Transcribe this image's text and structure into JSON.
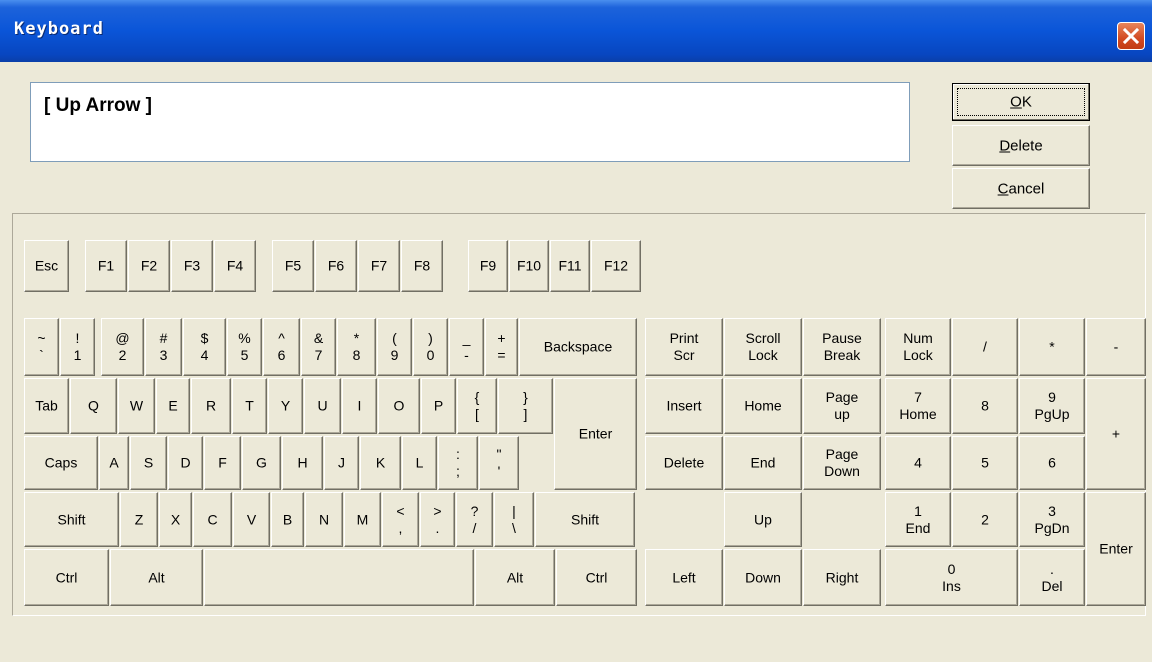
{
  "window": {
    "title": "Keyboard",
    "close_icon": "close-icon"
  },
  "display": {
    "value": "[ Up Arrow  ]"
  },
  "buttons": {
    "ok": {
      "label": "OK",
      "accel": "O",
      "rest": "K"
    },
    "delete": {
      "label": "Delete",
      "accel": "D",
      "rest": "elete"
    },
    "cancel": {
      "label": "Cancel",
      "accel": "C",
      "rest": "ancel"
    }
  },
  "keys": [
    {
      "id": "esc",
      "label": "Esc"
    },
    {
      "id": "f1",
      "label": "F1"
    },
    {
      "id": "f2",
      "label": "F2"
    },
    {
      "id": "f3",
      "label": "F3"
    },
    {
      "id": "f4",
      "label": "F4"
    },
    {
      "id": "f5",
      "label": "F5"
    },
    {
      "id": "f6",
      "label": "F6"
    },
    {
      "id": "f7",
      "label": "F7"
    },
    {
      "id": "f8",
      "label": "F8"
    },
    {
      "id": "f9",
      "label": "F9"
    },
    {
      "id": "f10",
      "label": "F10"
    },
    {
      "id": "f11",
      "label": "F11"
    },
    {
      "id": "f12",
      "label": "F12"
    },
    {
      "id": "tilde",
      "shift": "~",
      "base": "`"
    },
    {
      "id": "1",
      "shift": "!",
      "base": "1"
    },
    {
      "id": "2",
      "shift": "@",
      "base": "2"
    },
    {
      "id": "3",
      "shift": "#",
      "base": "3"
    },
    {
      "id": "4",
      "shift": "$",
      "base": "4"
    },
    {
      "id": "5",
      "shift": "%",
      "base": "5"
    },
    {
      "id": "6",
      "shift": "^",
      "base": "6"
    },
    {
      "id": "7",
      "shift": "&",
      "base": "7"
    },
    {
      "id": "8",
      "shift": "*",
      "base": "8"
    },
    {
      "id": "9",
      "shift": "(",
      "base": "9"
    },
    {
      "id": "0",
      "shift": ")",
      "base": "0"
    },
    {
      "id": "minus",
      "shift": "_",
      "base": "-"
    },
    {
      "id": "equals",
      "shift": "+",
      "base": "="
    },
    {
      "id": "backspace",
      "label": "Backspace"
    },
    {
      "id": "tab",
      "label": "Tab"
    },
    {
      "id": "q",
      "label": "Q"
    },
    {
      "id": "w",
      "label": "W"
    },
    {
      "id": "e",
      "label": "E"
    },
    {
      "id": "r",
      "label": "R"
    },
    {
      "id": "t",
      "label": "T"
    },
    {
      "id": "y",
      "label": "Y"
    },
    {
      "id": "u",
      "label": "U"
    },
    {
      "id": "i",
      "label": "I"
    },
    {
      "id": "o",
      "label": "O"
    },
    {
      "id": "p",
      "label": "P"
    },
    {
      "id": "lbracket",
      "shift": "{",
      "base": "["
    },
    {
      "id": "rbracket",
      "shift": "}",
      "base": "]"
    },
    {
      "id": "enter",
      "label": "Enter"
    },
    {
      "id": "caps",
      "label": "Caps"
    },
    {
      "id": "a",
      "label": "A"
    },
    {
      "id": "s",
      "label": "S"
    },
    {
      "id": "d",
      "label": "D"
    },
    {
      "id": "f",
      "label": "F"
    },
    {
      "id": "g",
      "label": "G"
    },
    {
      "id": "h",
      "label": "H"
    },
    {
      "id": "j",
      "label": "J"
    },
    {
      "id": "k",
      "label": "K"
    },
    {
      "id": "l",
      "label": "L"
    },
    {
      "id": "semicolon",
      "shift": ":",
      "base": ";"
    },
    {
      "id": "quote",
      "shift": "\"",
      "base": "'"
    },
    {
      "id": "lshift",
      "label": "Shift"
    },
    {
      "id": "z",
      "label": "Z"
    },
    {
      "id": "x",
      "label": "X"
    },
    {
      "id": "c",
      "label": "C"
    },
    {
      "id": "v",
      "label": "V"
    },
    {
      "id": "b",
      "label": "B"
    },
    {
      "id": "n",
      "label": "N"
    },
    {
      "id": "m",
      "label": "M"
    },
    {
      "id": "comma",
      "shift": "<",
      "base": ","
    },
    {
      "id": "period",
      "shift": ">",
      "base": "."
    },
    {
      "id": "slash",
      "shift": "?",
      "base": "/"
    },
    {
      "id": "backslash",
      "shift": "|",
      "base": "\\"
    },
    {
      "id": "rshift",
      "label": "Shift"
    },
    {
      "id": "lctrl",
      "label": "Ctrl"
    },
    {
      "id": "lalt",
      "label": "Alt"
    },
    {
      "id": "space",
      "label": ""
    },
    {
      "id": "ralt",
      "label": "Alt"
    },
    {
      "id": "rctrl",
      "label": "Ctrl"
    },
    {
      "id": "printscr",
      "label": "Print",
      "label2": "Scr"
    },
    {
      "id": "scrolllock",
      "label": "Scroll",
      "label2": "Lock"
    },
    {
      "id": "pause",
      "label": "Pause",
      "label2": "Break"
    },
    {
      "id": "insert",
      "label": "Insert"
    },
    {
      "id": "home",
      "label": "Home"
    },
    {
      "id": "pageup",
      "label": "Page",
      "label2": "up"
    },
    {
      "id": "delete",
      "label": "Delete"
    },
    {
      "id": "end",
      "label": "End"
    },
    {
      "id": "pagedown",
      "label": "Page",
      "label2": "Down"
    },
    {
      "id": "up",
      "label": "Up"
    },
    {
      "id": "left",
      "label": "Left"
    },
    {
      "id": "down",
      "label": "Down"
    },
    {
      "id": "right",
      "label": "Right"
    },
    {
      "id": "numlock",
      "label": "Num",
      "label2": "Lock"
    },
    {
      "id": "numdiv",
      "label": "/"
    },
    {
      "id": "nummul",
      "label": "*"
    },
    {
      "id": "numsub",
      "label": "-"
    },
    {
      "id": "num7",
      "label": "7",
      "label2": "Home"
    },
    {
      "id": "num8",
      "label": "8"
    },
    {
      "id": "num9",
      "label": "9",
      "label2": "PgUp"
    },
    {
      "id": "numadd",
      "label": "+"
    },
    {
      "id": "num4",
      "label": "4"
    },
    {
      "id": "num5",
      "label": "5"
    },
    {
      "id": "num6",
      "label": "6"
    },
    {
      "id": "num1",
      "label": "1",
      "label2": "End"
    },
    {
      "id": "num2",
      "label": "2"
    },
    {
      "id": "num3",
      "label": "3",
      "label2": "PgDn"
    },
    {
      "id": "numenter",
      "label": "Enter"
    },
    {
      "id": "num0",
      "label": "0",
      "label2": "Ins"
    },
    {
      "id": "numdot",
      "label": ".",
      "label2": "Del"
    }
  ]
}
